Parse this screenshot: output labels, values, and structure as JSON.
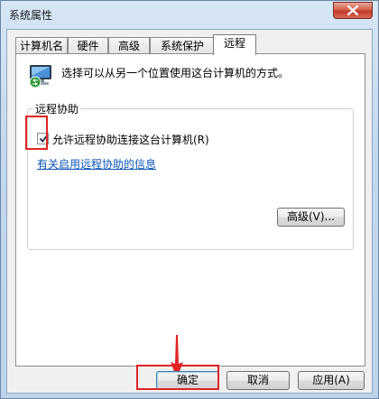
{
  "window": {
    "title": "系统属性"
  },
  "tabs": [
    "计算机名",
    "硬件",
    "高级",
    "系统保护",
    "远程"
  ],
  "remote": {
    "description": "选择可以从另一个位置使用这台计算机的方式。",
    "group_title": "远程协助",
    "checkbox_label": "允许远程协助连接这台计算机(R)",
    "checkbox_checked": true,
    "help_link": "有关启用远程协助的信息",
    "advanced_button": "高级(V)..."
  },
  "footer": {
    "ok": "确定",
    "cancel": "取消",
    "apply": "应用(A)"
  },
  "colors": {
    "highlight": "#e02424",
    "link": "#0a55b5"
  },
  "icons": [
    "close-icon",
    "remote-monitor-icon",
    "checkmark-icon",
    "down-arrow-icon"
  ]
}
